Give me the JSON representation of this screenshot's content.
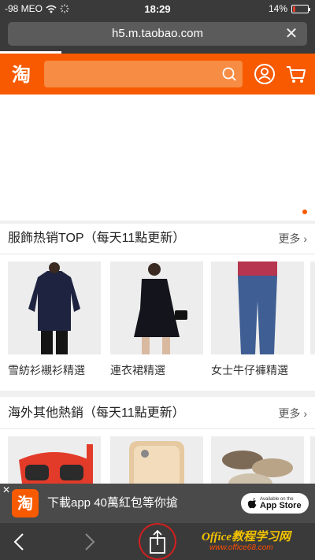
{
  "status_bar": {
    "carrier": "-98 MEO",
    "time": "18:29",
    "battery": "14%",
    "battery_level": 0.14,
    "battery_color": "#e23b2a"
  },
  "url_bar": {
    "url": "h5.m.taobao.com",
    "close_icon": "close-icon"
  },
  "header": {
    "logo_text": "淘",
    "brand_color": "#f75a00",
    "search_placeholder": ""
  },
  "sections": [
    {
      "title": "服飾热销TOP（每天11點更新）",
      "more": "更多",
      "products": [
        {
          "label": "雪紡衫襯衫精選",
          "icon": "shirt-image"
        },
        {
          "label": "連衣裙精選",
          "icon": "dress-image"
        },
        {
          "label": "女士牛仔褲精選",
          "icon": "jeans-image"
        }
      ]
    },
    {
      "title": "海外其他熱銷（每天11點更新）",
      "more": "更多",
      "products": [
        {
          "label": "",
          "icon": "dive-mask-image"
        },
        {
          "label": "",
          "icon": "phone-case-image"
        },
        {
          "label": "",
          "icon": "slippers-image"
        }
      ]
    }
  ],
  "app_banner": {
    "logo_text": "淘",
    "text": "下載app 40萬紅包等你搶",
    "store_small": "Available on the",
    "store_big": "App Store"
  },
  "watermark": {
    "main": "Office教程学习网",
    "sub": "www.office68.com"
  }
}
